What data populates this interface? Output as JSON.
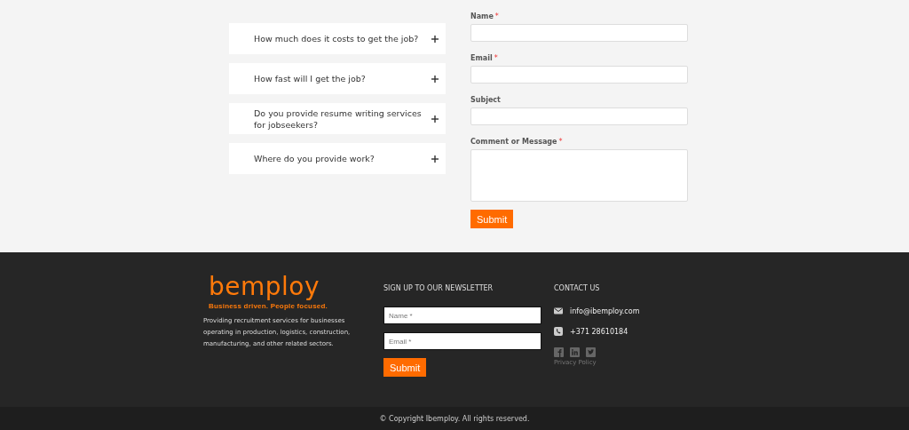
{
  "faq": {
    "items": [
      {
        "question": "How much does it costs to get the job?",
        "expanded": false
      },
      {
        "question": "How fast will I get the job?",
        "expanded": false
      },
      {
        "question": "Do you provide resume writing services for jobseekers?",
        "expanded": false
      },
      {
        "question": "Where do you provide work?",
        "expanded": false
      }
    ]
  },
  "contact_form": {
    "fields": [
      {
        "label": "Name",
        "required_mark": "*",
        "kind": "input"
      },
      {
        "label": "Email",
        "required_mark": "*",
        "kind": "input"
      },
      {
        "label": "Subject",
        "kind": "input"
      },
      {
        "label": "Comment or Message",
        "required_mark": "*",
        "kind": "textarea"
      }
    ],
    "submit": "Submit"
  },
  "footer": {
    "logo": {
      "name": "bemploy",
      "tagline": "Business driven. People focused."
    },
    "about": "Providing recruitment services for businesses operating in production, logistics, construction, manufacturing, and other related sectors.",
    "newsletter": {
      "title": "SIGN UP TO OUR NEWSLETTER",
      "fields": [
        {
          "placeholder": "Name *"
        },
        {
          "placeholder": "Email *"
        }
      ],
      "submit": "Submit"
    },
    "contact": {
      "title": "CONTACT US",
      "items": [
        {
          "kind": "email",
          "text": "info@ibemploy.com"
        },
        {
          "kind": "phone",
          "text": "+371 28610184"
        }
      ],
      "social": [
        {
          "kind": "facebook"
        },
        {
          "kind": "linkedin"
        },
        {
          "kind": "twitter"
        }
      ],
      "privacy_link": "Privacy Policy"
    }
  },
  "copyright": "© Copyright Ibemploy. All rights reserved."
}
